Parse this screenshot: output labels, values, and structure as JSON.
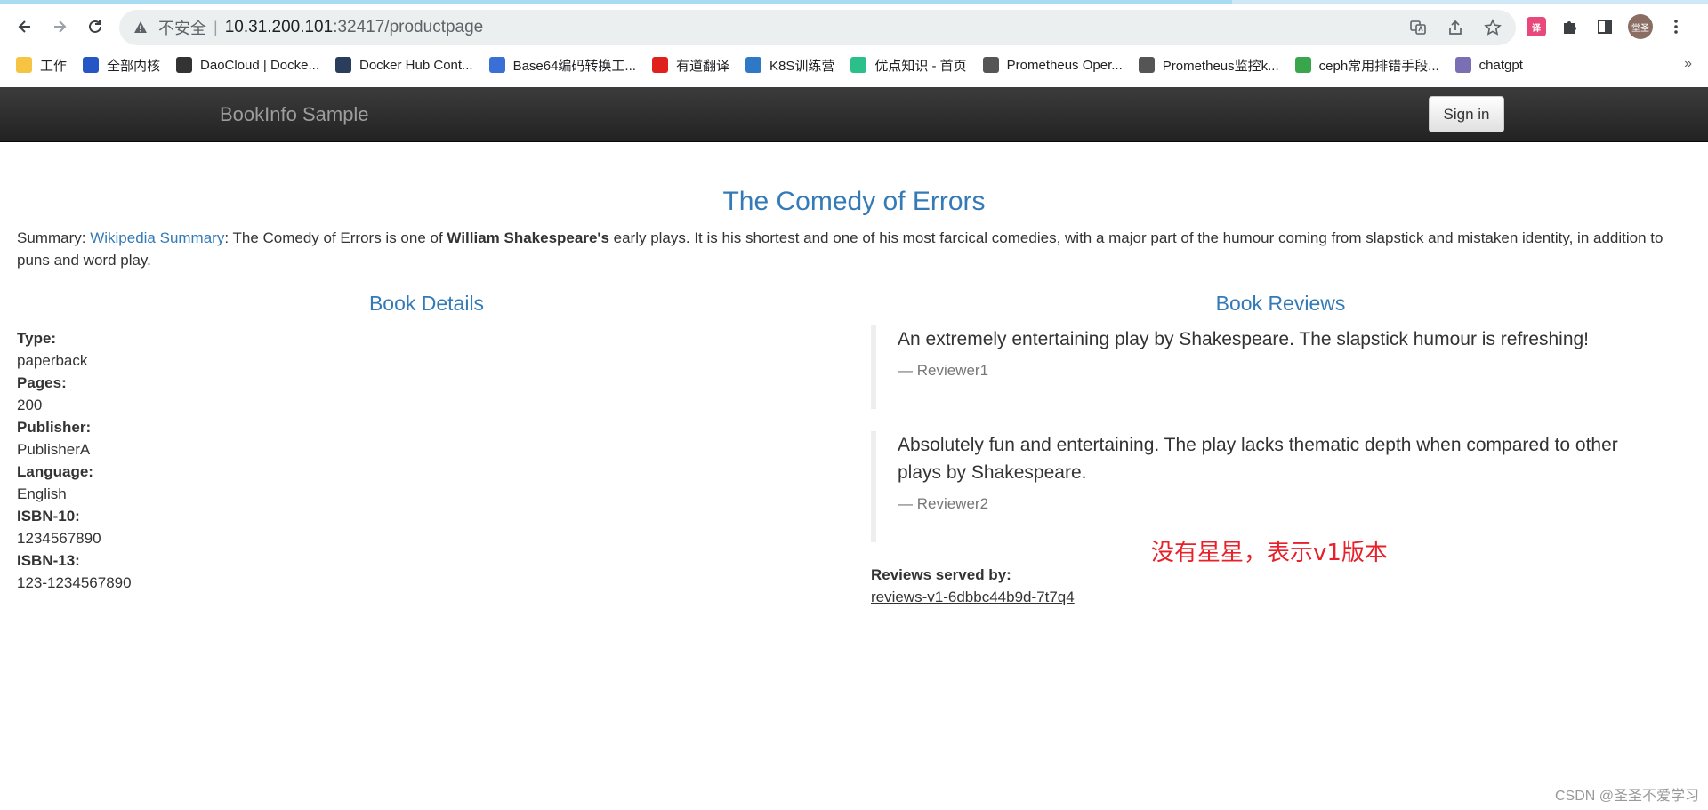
{
  "browser": {
    "insecure_label": "不安全",
    "separator": "|",
    "url_host": "10.31.200.101",
    "url_path": ":32417/productpage",
    "avatar_text": "堂圣",
    "ext_text": "译",
    "bookmarks": [
      {
        "label": "工作",
        "color": "#f6c343"
      },
      {
        "label": "全部内核",
        "color": "#2457c5"
      },
      {
        "label": "DaoCloud | Docke...",
        "color": "#333333"
      },
      {
        "label": "Docker Hub Cont...",
        "color": "#2a3e5c"
      },
      {
        "label": "Base64编码转换工...",
        "color": "#3a6fd8"
      },
      {
        "label": "有道翻译",
        "color": "#e0201b"
      },
      {
        "label": "K8S训练营",
        "color": "#2e78c5"
      },
      {
        "label": "优点知识 - 首页",
        "color": "#2bbf8a"
      },
      {
        "label": "Prometheus Oper...",
        "color": "#555555"
      },
      {
        "label": "Prometheus监控k...",
        "color": "#555555"
      },
      {
        "label": "ceph常用排错手段...",
        "color": "#3aa64b"
      },
      {
        "label": "chatgpt",
        "color": "#7a6fb5"
      }
    ],
    "bookmarks_more": "»"
  },
  "app": {
    "brand": "BookInfo Sample",
    "signin_label": "Sign in"
  },
  "book": {
    "title": "The Comedy of Errors",
    "summary_prefix": "Summary: ",
    "summary_link": "Wikipedia Summary",
    "summary_mid": ": The Comedy of Errors is one of ",
    "summary_bold": "William Shakespeare's",
    "summary_rest": " early plays. It is his shortest and one of his most farcical comedies, with a major part of the humour coming from slapstick and mistaken identity, in addition to puns and word play."
  },
  "details": {
    "heading": "Book Details",
    "items": [
      {
        "label": "Type:",
        "value": "paperback"
      },
      {
        "label": "Pages:",
        "value": "200"
      },
      {
        "label": "Publisher:",
        "value": "PublisherA"
      },
      {
        "label": "Language:",
        "value": "English"
      },
      {
        "label": "ISBN-10:",
        "value": "1234567890"
      },
      {
        "label": "ISBN-13:",
        "value": "123-1234567890"
      }
    ]
  },
  "reviews": {
    "heading": "Book Reviews",
    "items": [
      {
        "text": "An extremely entertaining play by Shakespeare. The slapstick humour is refreshing!",
        "by": "— Reviewer1"
      },
      {
        "text": "Absolutely fun and entertaining. The play lacks thematic depth when compared to other plays by Shakespeare.",
        "by": "— Reviewer2"
      }
    ],
    "served_label": "Reviews served by:",
    "served_value": "reviews-v1-6dbbc44b9d-7t7q4"
  },
  "annotation": "没有星星，表示v1版本",
  "watermark": "CSDN @圣圣不爱学习"
}
